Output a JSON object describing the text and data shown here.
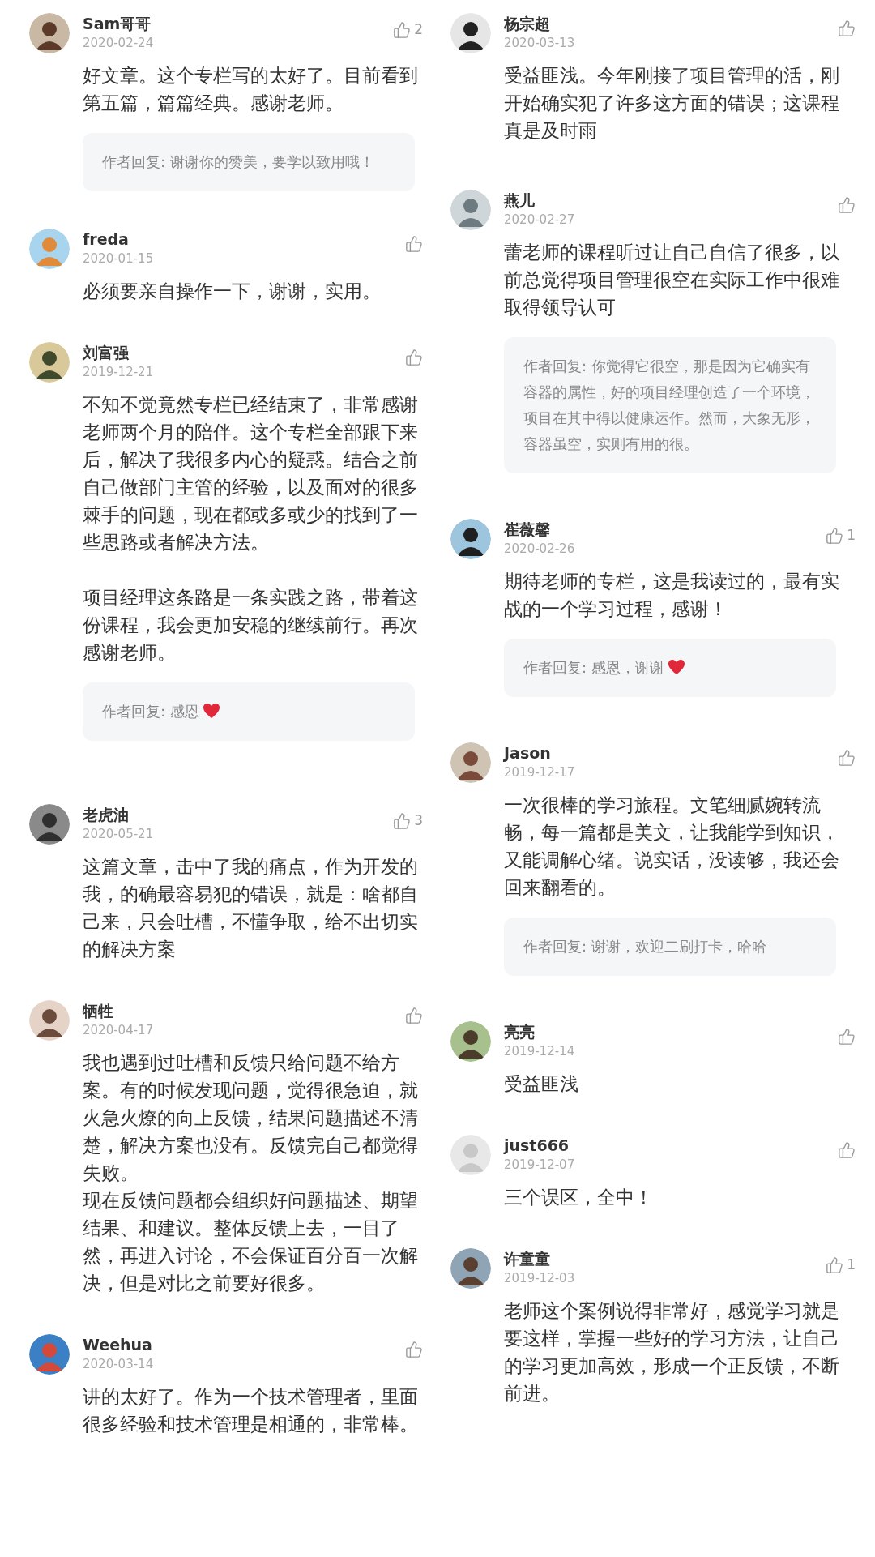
{
  "columns": [
    {
      "sections": [
        {
          "comments": [
            {
              "name": "Sam哥哥",
              "date": "2020-02-24",
              "likes": "2",
              "text": "好文章。这个专栏写的太好了。目前看到第五篇，篇篇经典。感谢老师。",
              "reply": {
                "text": "作者回复: 谢谢你的赞美，要学以致用哦！",
                "heart": false
              }
            },
            {
              "name": "freda",
              "date": "2020-01-15",
              "text": "必须要亲自操作一下，谢谢，实用。"
            },
            {
              "name": "刘富强",
              "date": "2019-12-21",
              "paragraphs": [
                "不知不觉竟然专栏已经结束了，非常感谢老师两个月的陪伴。这个专栏全部跟下来后，解决了我很多内心的疑惑。结合之前自己做部门主管的经验，以及面对的很多棘手的问题，现在都或多或少的找到了一些思路或者解决方法。",
                "项目经理这条路是一条实践之路，带着这份课程，我会更加安稳的继续前行。再次感谢老师。"
              ],
              "reply": {
                "text": "作者回复: 感恩",
                "heart": true
              }
            }
          ]
        },
        {
          "comments": [
            {
              "name": "老虎油",
              "date": "2020-05-21",
              "likes": "3",
              "text": "这篇文章，击中了我的痛点，作为开发的我，的确最容易犯的错误，就是：啥都自己来，只会吐槽，不懂争取，给不出切实的解决方案"
            },
            {
              "name": "牺牲",
              "date": "2020-04-17",
              "lines": [
                "我也遇到过吐槽和反馈只给问题不给方案。有的时候发现问题，觉得很急迫，就火急火燎的向上反馈，结果问题描述不清楚，解决方案也没有。反馈完自己都觉得失败。",
                "现在反馈问题都会组织好问题描述、期望结果、和建议。整体反馈上去，一目了然，再进入讨论，不会保证百分百一次解决，但是对比之前要好很多。"
              ]
            },
            {
              "name": "Weehua",
              "date": "2020-03-14",
              "text": "讲的太好了。作为一个技术管理者，里面很多经验和技术管理是相通的，非常棒。"
            }
          ]
        }
      ]
    },
    {
      "sections": [
        {
          "comments": [
            {
              "name": "杨宗超",
              "date": "2020-03-13",
              "text": "受益匪浅。今年刚接了项目管理的活，刚开始确实犯了许多这方面的错误；这课程真是及时雨"
            }
          ]
        },
        {
          "comments": [
            {
              "name": "燕儿",
              "date": "2020-02-27",
              "text": "蕾老师的课程听过让自己自信了很多，以前总觉得项目管理很空在实际工作中很难取得领导认可",
              "reply": {
                "text": "作者回复: 你觉得它很空，那是因为它确实有容器的属性，好的项目经理创造了一个环境，项目在其中得以健康运作。然而，大象无形，容器虽空，实则有用的很。",
                "heart": false
              }
            }
          ]
        },
        {
          "comments": [
            {
              "name": "崔薇馨",
              "date": "2020-02-26",
              "likes": "1",
              "text": "期待老师的专栏，这是我读过的，最有实战的一个学习过程，感谢！",
              "reply": {
                "text": "作者回复: 感恩，谢谢",
                "heart": true
              }
            }
          ]
        },
        {
          "comments": [
            {
              "name": "Jason",
              "date": "2019-12-17",
              "text": "一次很棒的学习旅程。文笔细腻婉转流畅，每一篇都是美文，让我能学到知识，又能调解心绪。说实话，没读够，我还会回来翻看的。",
              "reply": {
                "text": "作者回复: 谢谢，欢迎二刷打卡，哈哈",
                "heart": false
              }
            }
          ]
        },
        {
          "comments": [
            {
              "name": "亮亮",
              "date": "2019-12-14",
              "text": "受益匪浅"
            },
            {
              "name": "just666",
              "date": "2019-12-07",
              "text": "三个误区，全中！"
            },
            {
              "name": "许童童",
              "date": "2019-12-03",
              "likes": "1",
              "text": "老师这个案例说得非常好，感觉学习就是要这样，掌握一些好的学习方法，让自己的学习更加高效，形成一个正反馈，不断前进。"
            }
          ]
        }
      ]
    }
  ]
}
